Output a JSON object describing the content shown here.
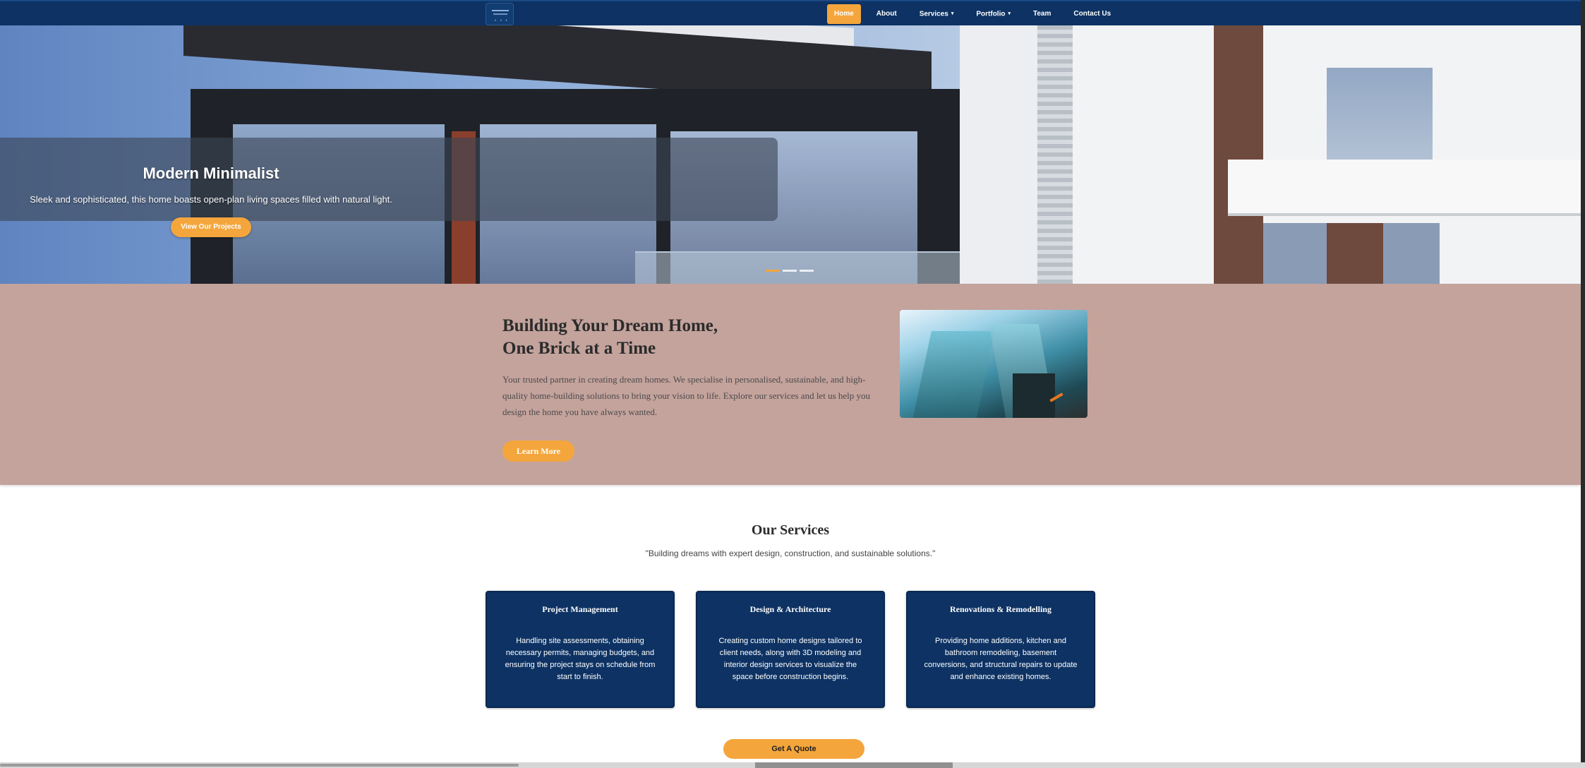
{
  "nav": {
    "items": [
      {
        "label": "Home",
        "active": true
      },
      {
        "label": "About"
      },
      {
        "label": "Services",
        "has_dropdown": true
      },
      {
        "label": "Portfolio",
        "has_dropdown": true
      },
      {
        "label": "Team"
      },
      {
        "label": "Contact Us"
      }
    ],
    "caret_glyph": "▾"
  },
  "hero": {
    "title": "Modern Minimalist",
    "text": "Sleek and sophisticated, this home boasts open-plan living spaces filled with natural light.",
    "button": "View Our Projects",
    "slides": 3,
    "active_slide": 1
  },
  "about": {
    "title_line1": "Building Your Dream Home,",
    "title_line2": "One Brick at a Time",
    "text": "Your trusted partner in creating dream homes. We specialise in personalised, sustainable, and high-quality home-building solutions to bring your vision to life. Explore our services and let us help you design the home you have always wanted.",
    "button": "Learn More"
  },
  "services": {
    "title": "Our Services",
    "subtitle": "\"Building dreams with expert design, construction, and sustainable solutions.\"",
    "cards": [
      {
        "title": "Project Management",
        "text": "Handling site assessments, obtaining necessary permits, managing budgets, and ensuring the project stays on schedule from start to finish."
      },
      {
        "title": "Design & Architecture",
        "text": "Creating custom home designs tailored to client needs, along with 3D modeling and interior design services to visualize the space before construction begins."
      },
      {
        "title": "Renovations & Remodelling",
        "text": "Providing home additions, kitchen and bathroom remodeling, basement conversions, and structural repairs to update and enhance existing homes."
      }
    ],
    "quote_button": "Get A Quote"
  },
  "colors": {
    "navy": "#0d3263",
    "accent": "#f4a63c",
    "about_bg": "#c3a39c"
  }
}
